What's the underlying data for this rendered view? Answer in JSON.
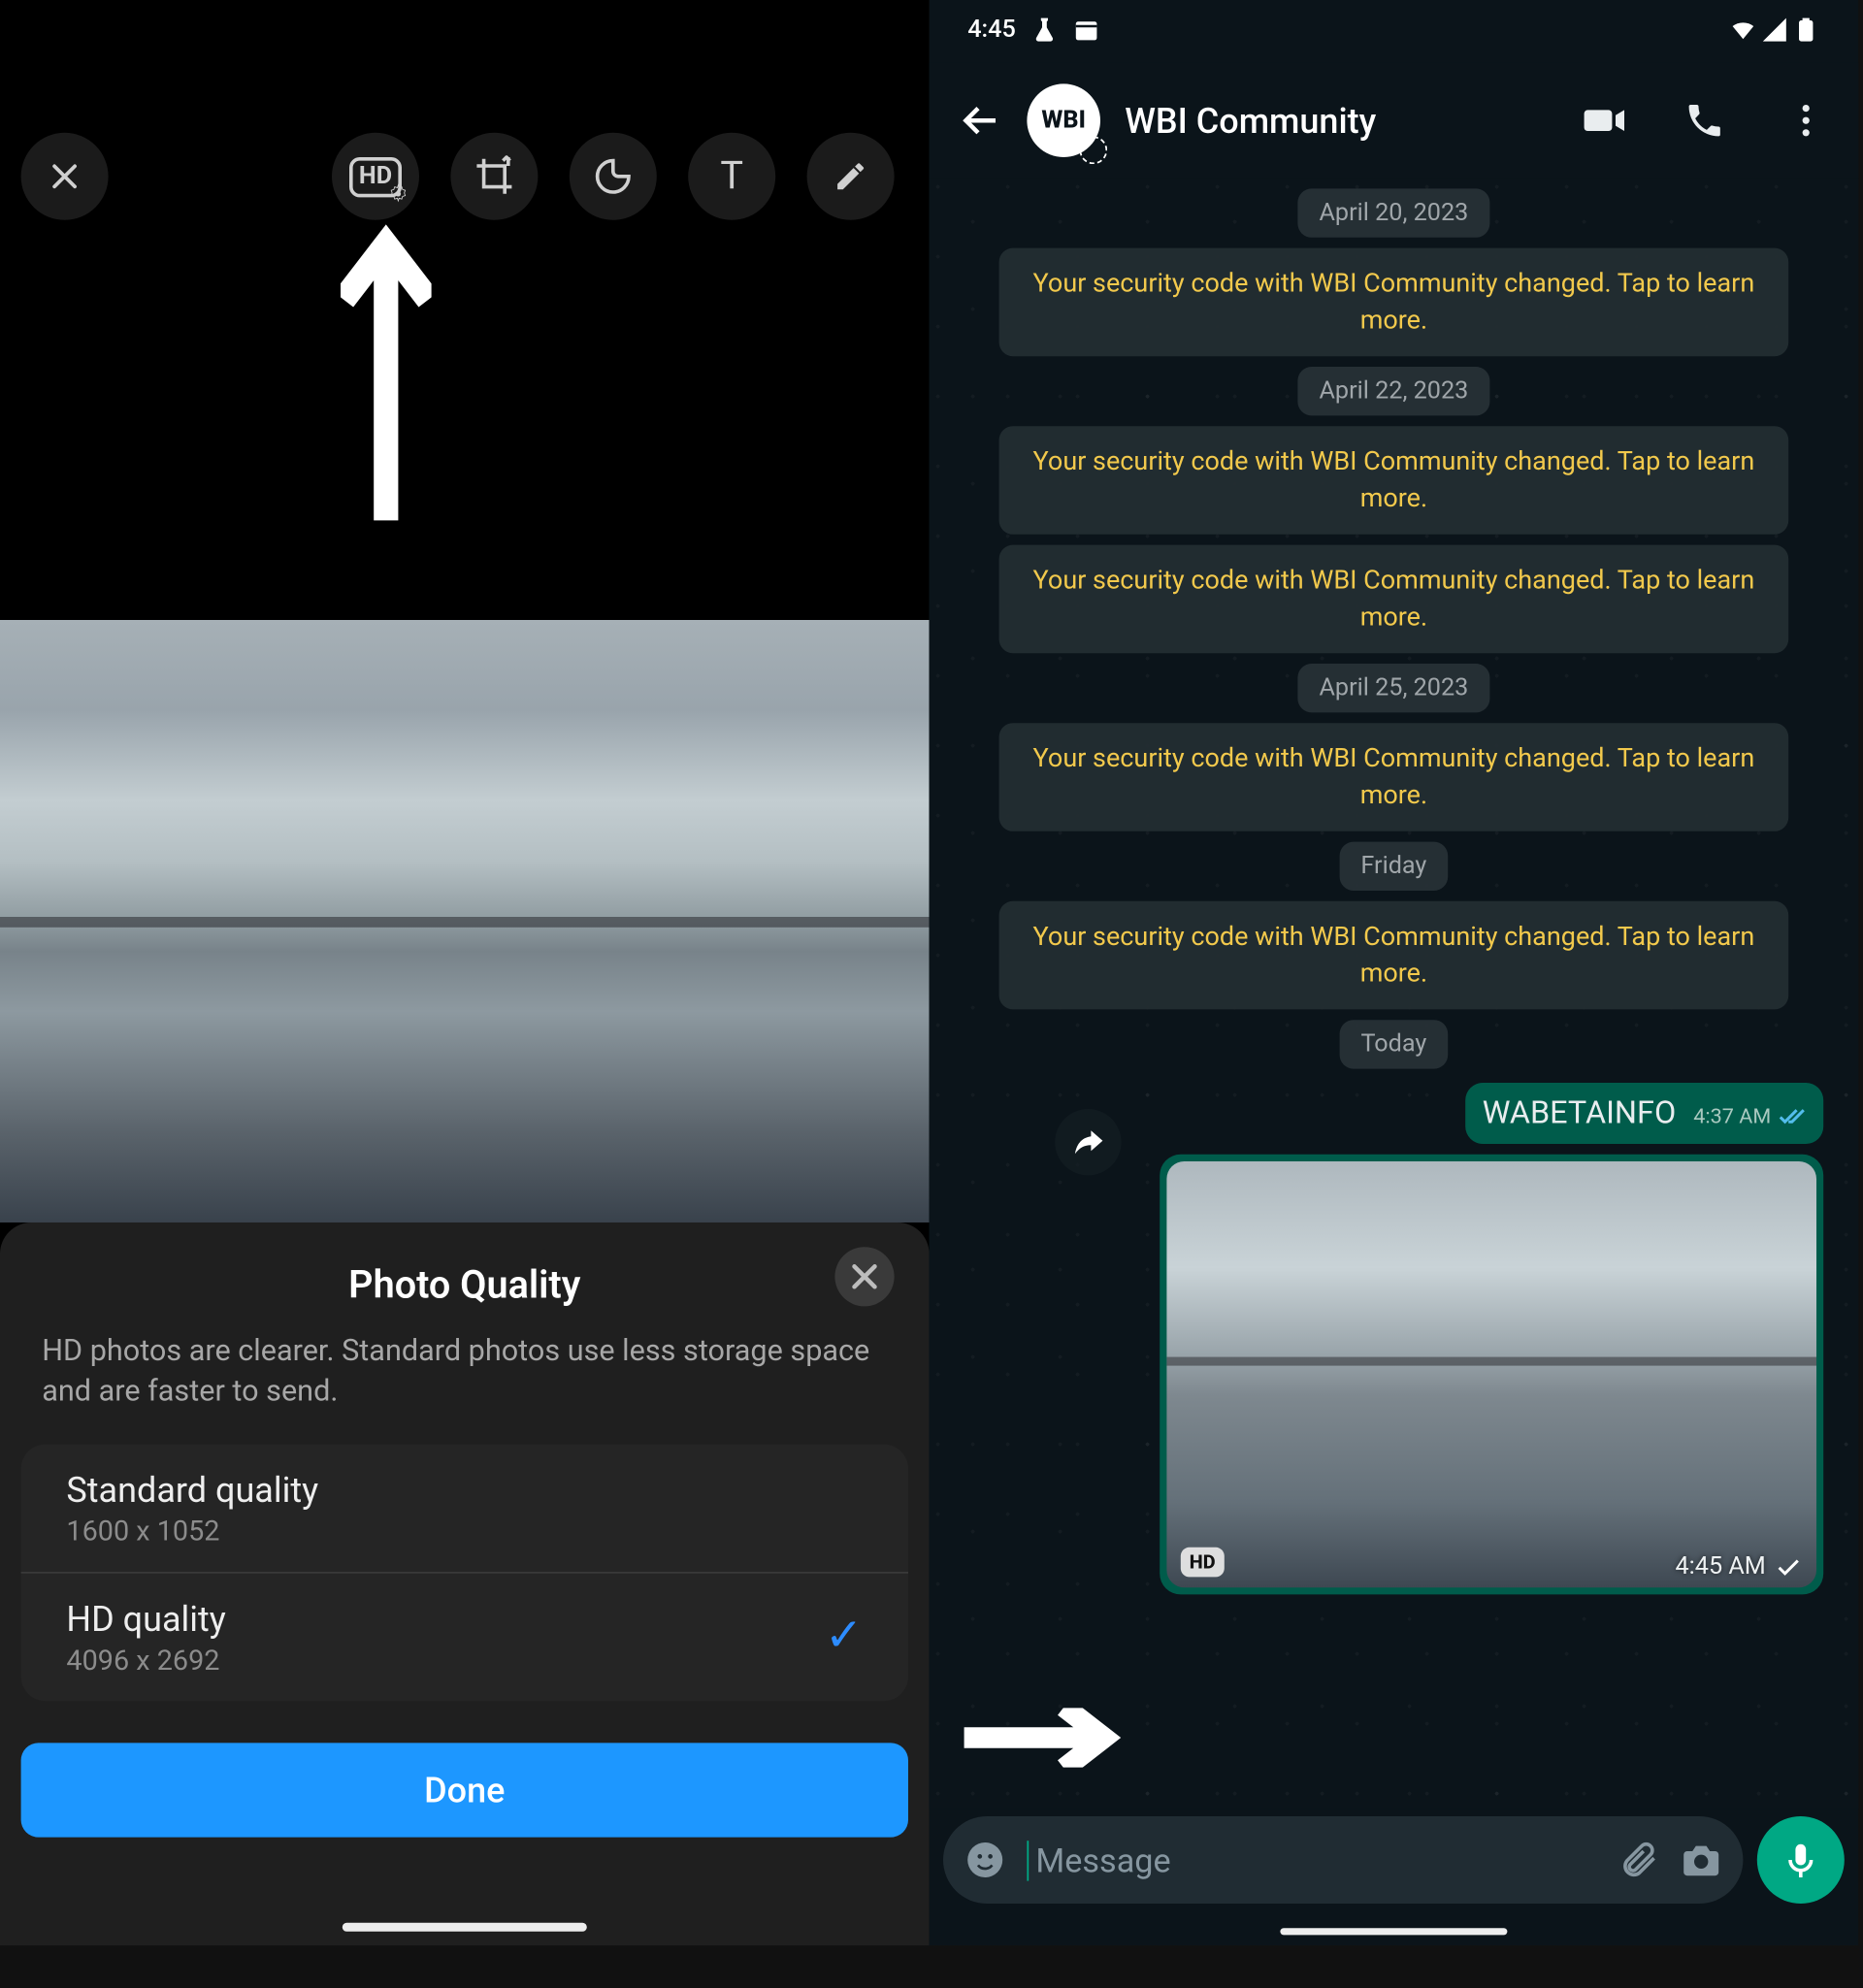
{
  "left": {
    "sheet": {
      "title": "Photo Quality",
      "description": "HD photos are clearer. Standard photos use less storage space and are faster to send.",
      "options": [
        {
          "label": "Standard quality",
          "resolution": "1600 x 1052",
          "selected": false
        },
        {
          "label": "HD quality",
          "resolution": "4096 x 2692",
          "selected": true
        }
      ],
      "done_label": "Done"
    },
    "toolbar_icons": [
      "close",
      "hd",
      "crop",
      "sticker",
      "text",
      "draw"
    ]
  },
  "right": {
    "status": {
      "time": "4:45",
      "icons": [
        "flask",
        "calendar",
        "wifi",
        "signal",
        "battery"
      ]
    },
    "header": {
      "title": "WBI Community",
      "avatar_text": "WBI",
      "actions": [
        "video",
        "voice",
        "menu"
      ]
    },
    "chat": [
      {
        "type": "pill",
        "text": "April 20, 2023"
      },
      {
        "type": "security",
        "text": "Your security code with WBI Community changed. Tap to learn more."
      },
      {
        "type": "pill",
        "text": "April 22, 2023"
      },
      {
        "type": "security",
        "text": "Your security code with WBI Community changed. Tap to learn more."
      },
      {
        "type": "security",
        "text": "Your security code with WBI Community changed. Tap to learn more."
      },
      {
        "type": "pill",
        "text": "April 25, 2023"
      },
      {
        "type": "security",
        "text": "Your security code with WBI Community changed. Tap to learn more."
      },
      {
        "type": "pill",
        "text": "Friday"
      },
      {
        "type": "security",
        "text": "Your security code with WBI Community changed. Tap to learn more."
      },
      {
        "type": "pill",
        "text": "Today"
      },
      {
        "type": "text_out",
        "text": "WABETAINFO",
        "time": "4:37 AM",
        "ticks": "read"
      },
      {
        "type": "image_out",
        "hd": true,
        "hd_label": "HD",
        "time": "4:45 AM",
        "ticks": "sent"
      }
    ],
    "input": {
      "placeholder": "Message"
    }
  }
}
